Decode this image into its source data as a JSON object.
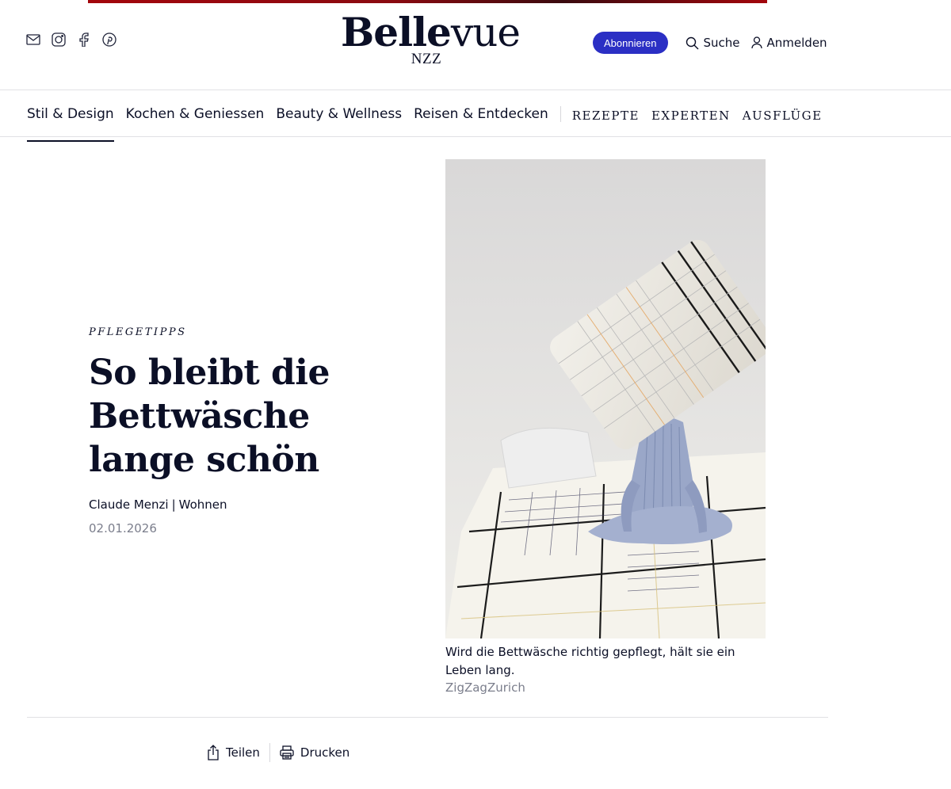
{
  "brand": {
    "name_bold": "Belle",
    "name_light": "vue",
    "sub": "NZZ",
    "accent": "#2b2fc4",
    "stripe": "#a3060c"
  },
  "social": [
    {
      "icon": "mail-icon"
    },
    {
      "icon": "instagram-icon"
    },
    {
      "icon": "facebook-icon"
    },
    {
      "icon": "pinterest-icon"
    }
  ],
  "header": {
    "subscribe_label": "Abonnieren",
    "search_label": "Suche",
    "login_label": "Anmelden"
  },
  "nav": {
    "items": [
      {
        "label": "Stil & Design",
        "active": true
      },
      {
        "label": "Kochen & Geniessen"
      },
      {
        "label": "Beauty & Wellness"
      },
      {
        "label": "Reisen & Entdecken"
      }
    ],
    "caps": [
      {
        "label": "REZEPTE"
      },
      {
        "label": "EXPERTEN"
      },
      {
        "label": "AUSFLÜGE"
      }
    ]
  },
  "article": {
    "kicker": "PFLEGETIPPS",
    "title": "So bleibt die Bettwäsche lange schön",
    "author": "Claude Menzi",
    "separator": "|",
    "category": "Wohnen",
    "date": "02.01.2026"
  },
  "image": {
    "caption": "Wird die Bettwäsche richtig gepflegt, hält sie ein Leben lang.",
    "credit": "ZigZagZurich"
  },
  "actions": {
    "share_label": "Teilen",
    "print_label": "Drucken"
  }
}
